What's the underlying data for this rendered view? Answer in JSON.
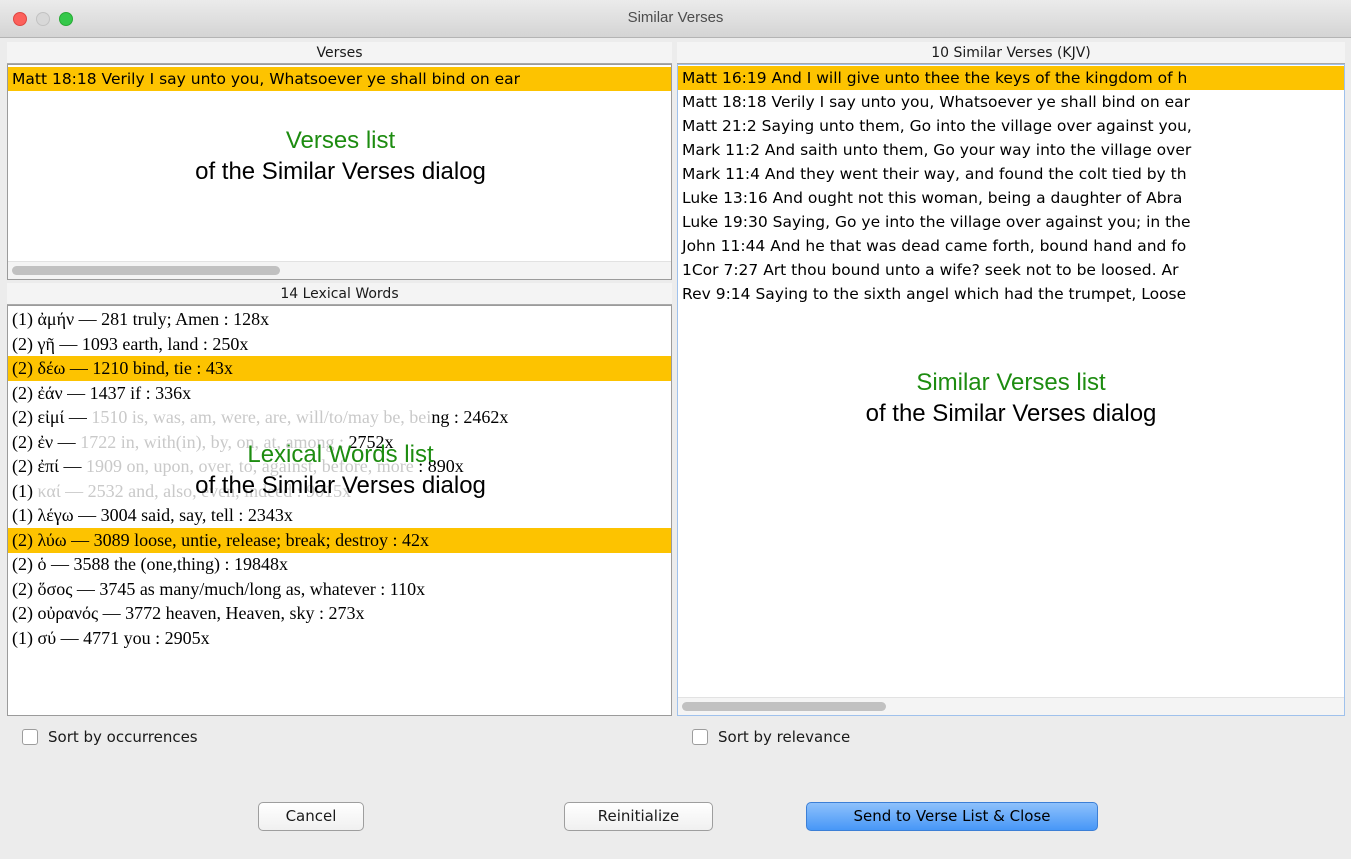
{
  "window": {
    "title": "Similar Verses"
  },
  "verses_panel": {
    "header": "Verses",
    "rows": [
      {
        "text": "Matt 18:18  Verily I say unto you, Whatsoever ye shall bind on ear",
        "selected": true
      }
    ],
    "annotation": {
      "green": "Verses list",
      "black": "of the Similar Verses dialog"
    }
  },
  "lexical_panel": {
    "header": "14 Lexical Words",
    "rows": [
      {
        "text": "(1)  ἀμήν — 281 truly; Amen : 128x",
        "selected": false
      },
      {
        "text": "(2)  γῆ — 1093 earth, land : 250x",
        "selected": false
      },
      {
        "text": "(2)  δέω — 1210 bind, tie : 43x",
        "selected": true
      },
      {
        "text": "(2)  ἐάν — 1437 if : 336x",
        "selected": false
      },
      {
        "pre": "(2)  εἰμί — ",
        "faded": "1510 is, was, am, were, are, will/to/may be, bei",
        "post": "ng : 2462x",
        "selected": false
      },
      {
        "pre": "(2)  ἐν — ",
        "faded": "1722 in, with(in), by, on, at, among : ",
        "post": "2752x",
        "selected": false
      },
      {
        "pre": "(2)  ἐπί — ",
        "faded": "1909 on, upon, over, to, against, before, more",
        "post": " : 890x",
        "selected": false
      },
      {
        "pre": "(1)  ",
        "faded": "καί — 2532 and, also, even, indeed : 9015x",
        "post": "",
        "selected": false
      },
      {
        "text": "(1)  λέγω — 3004 said, say, tell : 2343x",
        "selected": false
      },
      {
        "text": "(2)  λύω — 3089 loose, untie, release; break; destroy : 42x",
        "selected": true
      },
      {
        "text": "(2)  ὁ — 3588 the (one,thing) : 19848x",
        "selected": false
      },
      {
        "text": "(2)  ὅσος — 3745 as many/much/long as, whatever : 110x",
        "selected": false
      },
      {
        "text": "(2)  οὐρανός — 3772 heaven, Heaven, sky : 273x",
        "selected": false
      },
      {
        "text": "(1)  σύ — 4771 you : 2905x",
        "selected": false
      }
    ],
    "annotation": {
      "green": "Lexical Words list",
      "black": "of the Similar Verses dialog"
    }
  },
  "similar_panel": {
    "header": "10 Similar Verses (KJV)",
    "rows": [
      {
        "text": "Matt 16:19  And I will give unto thee the keys of the kingdom of h",
        "selected": true
      },
      {
        "text": "Matt 18:18  Verily I say unto you, Whatsoever ye shall bind on ear",
        "selected": false
      },
      {
        "text": "Matt 21:2  Saying unto them, Go into the village over against you,",
        "selected": false
      },
      {
        "text": "Mark 11:2  And saith unto them, Go your way into the village over",
        "selected": false
      },
      {
        "text": "Mark 11:4  And they went their way, and found the colt tied by th",
        "selected": false
      },
      {
        "text": "Luke 13:16  And ought not this woman, being a daughter of Abra",
        "selected": false
      },
      {
        "text": "Luke 19:30  Saying, Go ye into the village over against you; in the",
        "selected": false
      },
      {
        "text": "John 11:44  And he that was dead came forth, bound hand and fo",
        "selected": false
      },
      {
        "text": "1Cor 7:27  Art thou bound unto a wife? seek not to be loosed. Ar",
        "selected": false
      },
      {
        "text": "Rev 9:14  Saying to the sixth angel which had the trumpet, Loose",
        "selected": false
      }
    ],
    "annotation": {
      "green": "Similar Verses list",
      "black": "of the Similar Verses dialog"
    }
  },
  "options": {
    "sort_occurrences": {
      "label": "Sort by occurrences",
      "checked": false
    },
    "sort_relevance": {
      "label": "Sort by relevance",
      "checked": false
    }
  },
  "buttons": {
    "cancel": "Cancel",
    "reinitialize": "Reinitialize",
    "send": "Send to Verse List & Close"
  },
  "colors": {
    "selection": "#fdc300",
    "annotation_green": "#1d8c10",
    "primary_button": "#4797f7"
  }
}
